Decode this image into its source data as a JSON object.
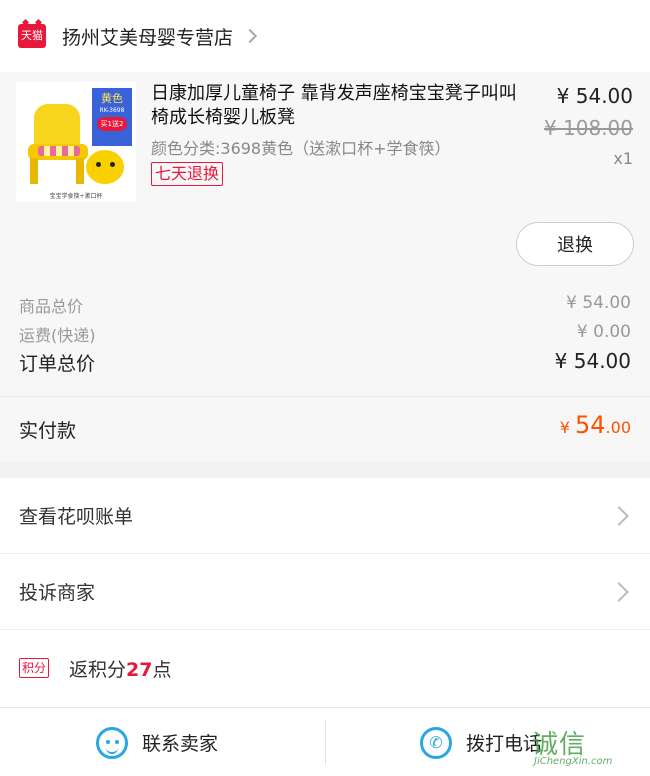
{
  "store": {
    "platform_badge": "天猫",
    "name": "扬州艾美母婴专营店"
  },
  "product": {
    "title": "日康加厚儿童椅子 靠背发声座椅宝宝凳子叫叫椅成长椅婴儿板凳",
    "sku": "颜色分类:3698黄色（送漱口杯+学食筷）",
    "return_policy": "七天退换",
    "price": "¥ 54.00",
    "original_price": "¥ 108.00",
    "quantity": "x1",
    "refund_button": "退换",
    "image": {
      "tag_color": "黄色",
      "tag_model": "RK-3698",
      "tag_gift": "买1送2",
      "caption": "宝宝学食筷+漱口杯"
    }
  },
  "summary": {
    "goods_total_label": "商品总价",
    "goods_total_value": "¥ 54.00",
    "shipping_label": "运费(快递)",
    "shipping_value": "¥ 0.00",
    "order_total_label": "订单总价",
    "order_total_value": "¥ 54.00"
  },
  "payment": {
    "label": "实付款",
    "currency": "¥ ",
    "integer": "54",
    "decimal": ".00",
    "color": "#ff5000"
  },
  "links": {
    "huabei": "查看花呗账单",
    "complaint": "投诉商家",
    "points_badge": "积分",
    "points_prefix": "返积分",
    "points_value": "27",
    "points_suffix": "点"
  },
  "bottom_bar": {
    "contact_seller": "联系卖家",
    "call_phone": "拨打电话"
  },
  "watermark": {
    "title": "诚信",
    "url": "JiChengXin.com"
  },
  "colors": {
    "accent_red": "#e8173c",
    "icon_blue": "#2aa6e6",
    "pay_orange": "#ff5000"
  },
  "icons": [
    "tmall-logo-icon",
    "chevron-right-icon",
    "chat-face-icon",
    "phone-icon"
  ]
}
